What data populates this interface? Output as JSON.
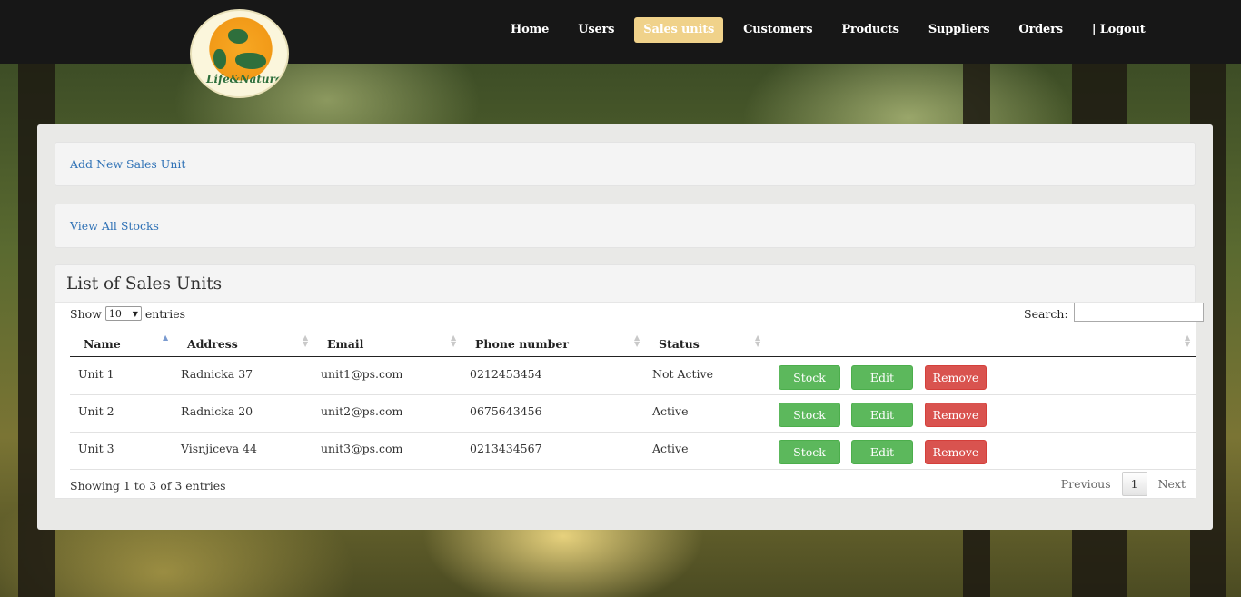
{
  "nav": {
    "logo_text": "Life&Nature",
    "items": [
      {
        "label": "Home",
        "active": false
      },
      {
        "label": "Users",
        "active": false
      },
      {
        "label": "Sales units",
        "active": true
      },
      {
        "label": "Customers",
        "active": false
      },
      {
        "label": "Products",
        "active": false
      },
      {
        "label": "Suppliers",
        "active": false
      },
      {
        "label": "Orders",
        "active": false
      },
      {
        "label": "| Logout",
        "active": false
      }
    ]
  },
  "actions": {
    "add_new": "Add New Sales Unit",
    "view_stocks": "View All Stocks"
  },
  "list": {
    "title": "List of Sales Units",
    "show_label": "Show",
    "entries_value": "10",
    "entries_label": "entries",
    "search_label": "Search:",
    "columns": [
      "Name",
      "Address",
      "Email",
      "Phone number",
      "Status"
    ],
    "rows": [
      {
        "name": "Unit 1",
        "address": "Radnicka 37",
        "email": "unit1@ps.com",
        "phone": "0212453454",
        "status": "Not Active"
      },
      {
        "name": "Unit 2",
        "address": "Radnicka 20",
        "email": "unit2@ps.com",
        "phone": "0675643456",
        "status": "Active"
      },
      {
        "name": "Unit 3",
        "address": "Visnjiceva 44",
        "email": "unit3@ps.com",
        "phone": "0213434567",
        "status": "Active"
      }
    ],
    "row_buttons": {
      "stock": "Stock",
      "edit": "Edit",
      "remove": "Remove"
    },
    "info": "Showing 1 to 3 of 3 entries",
    "pagination": {
      "previous": "Previous",
      "current": "1",
      "next": "Next"
    }
  },
  "colors": {
    "navbar": "#171717",
    "active_nav": "#f0d28a",
    "link": "#3072b6",
    "success": "#5cb85c",
    "danger": "#d9534f"
  }
}
